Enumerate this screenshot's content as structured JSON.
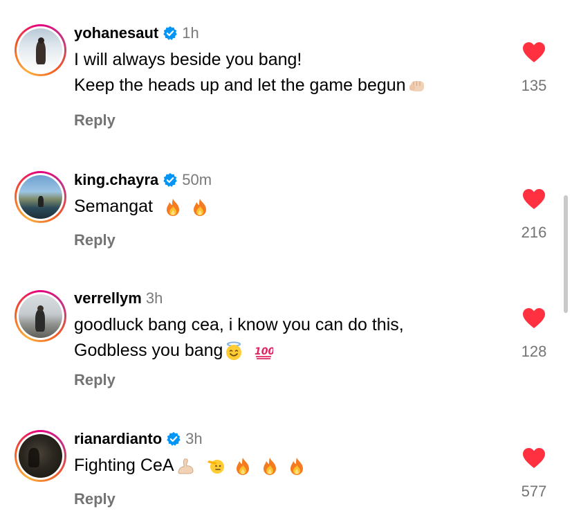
{
  "colors": {
    "text": "#000000",
    "secondary": "#737373",
    "timestamp": "#7a7a7a",
    "heart": "#ff3040",
    "verified": "#0095f6"
  },
  "icons": {
    "like": "heart-filled-icon",
    "verified": "verified-badge-icon"
  },
  "comments": [
    {
      "username": "yohanesaut",
      "verified": true,
      "time": "1h",
      "lines": [
        "I will always beside you bang!",
        "Keep the heads up and let the game begun"
      ],
      "emojis": [
        "👊🏻"
      ],
      "likes": "135",
      "reply_label": "Reply"
    },
    {
      "username": "king.chayra",
      "verified": true,
      "time": "50m",
      "lines": [
        "Semangat"
      ],
      "emojis": [
        "🔥",
        "🔥"
      ],
      "likes": "216",
      "reply_label": "Reply"
    },
    {
      "username": "verrellym",
      "verified": false,
      "time": "3h",
      "lines": [
        "goodluck bang cea, i know you can do this,",
        "Godbless you bang"
      ],
      "emojis": [
        "😇",
        "💯"
      ],
      "likes": "128",
      "reply_label": "Reply"
    },
    {
      "username": "rianardianto",
      "verified": true,
      "time": "3h",
      "lines": [
        "Fighting CeA"
      ],
      "emojis": [
        "💪🏻",
        "🫡",
        "🔥",
        "🔥",
        "🔥"
      ],
      "likes": "577",
      "reply_label": "Reply"
    }
  ]
}
